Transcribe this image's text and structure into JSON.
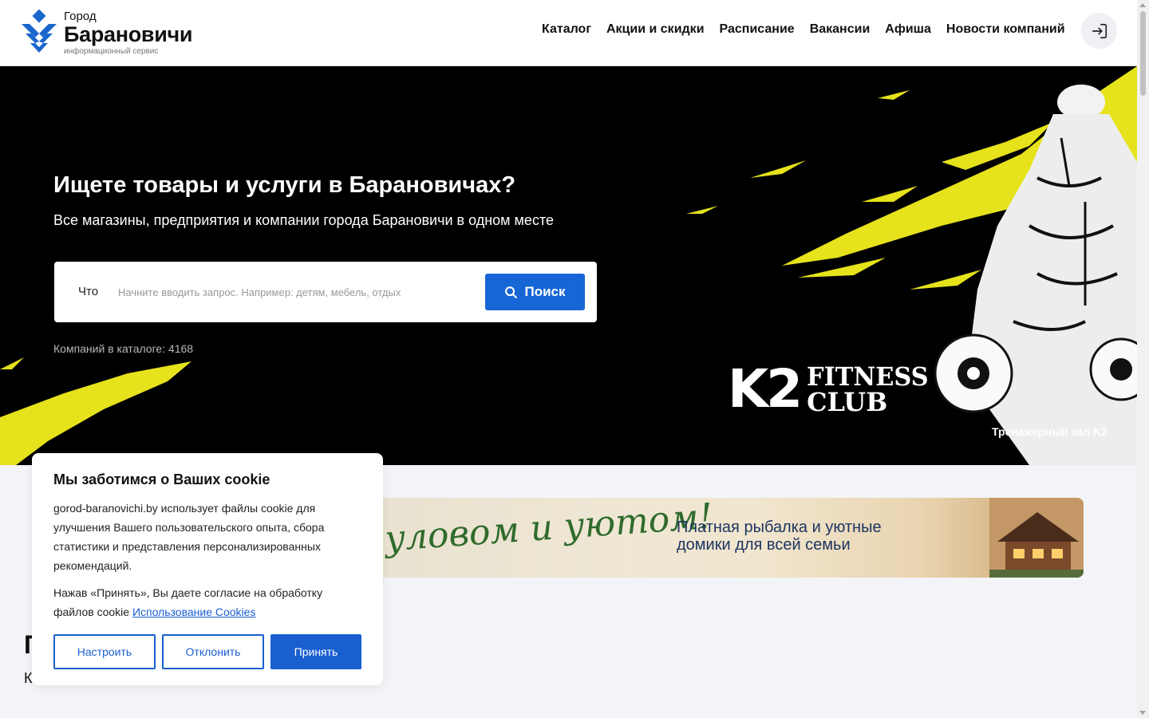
{
  "header": {
    "logo": {
      "small": "Город",
      "big": "Барановичи",
      "sub": "информационный сервис"
    },
    "nav": [
      "Каталог",
      "Акции и скидки",
      "Расписание",
      "Вакансии",
      "Афиша",
      "Новости компаний"
    ],
    "login_icon": "login-icon"
  },
  "hero": {
    "title": "Ищете товары и услуги в Барановичах?",
    "subtitle": "Все магазины, предприятия и компании города Барановичи в одном месте",
    "search": {
      "label": "Что",
      "placeholder": "Начните вводить запрос. Например: детям, мебель, отдых",
      "value": "",
      "button": "Поиск"
    },
    "catalog_count": "Компаний в каталоге: 4168",
    "ad": {
      "logo_big": "K2",
      "logo_line1": "FITNESS",
      "logo_line2": "CLUB",
      "caption": "Тренажерный зал K2"
    }
  },
  "banner": {
    "script": "уловом и уютом!",
    "line1": "Платная рыбалка и уютные",
    "line2": "домики для всей семьи"
  },
  "section": {
    "title": "П",
    "subtitle": "К"
  },
  "cookie": {
    "title": "Мы заботимся о Ваших cookie",
    "text1": "gorod-baranovichi.by использует файлы cookie для улучшения Вашего пользовательского опыта, сбора статистики и представления персонализированных рекомендаций.",
    "text2": "Нажав «Принять», Вы даете согласие на обработку файлов cookie",
    "link": "Использование Cookies",
    "buttons": {
      "configure": "Настроить",
      "decline": "Отклонить",
      "accept": "Принять"
    }
  },
  "colors": {
    "accent": "#1766d6",
    "brand_blue": "#1a66cc",
    "hero_yellow": "#e6e21b"
  }
}
